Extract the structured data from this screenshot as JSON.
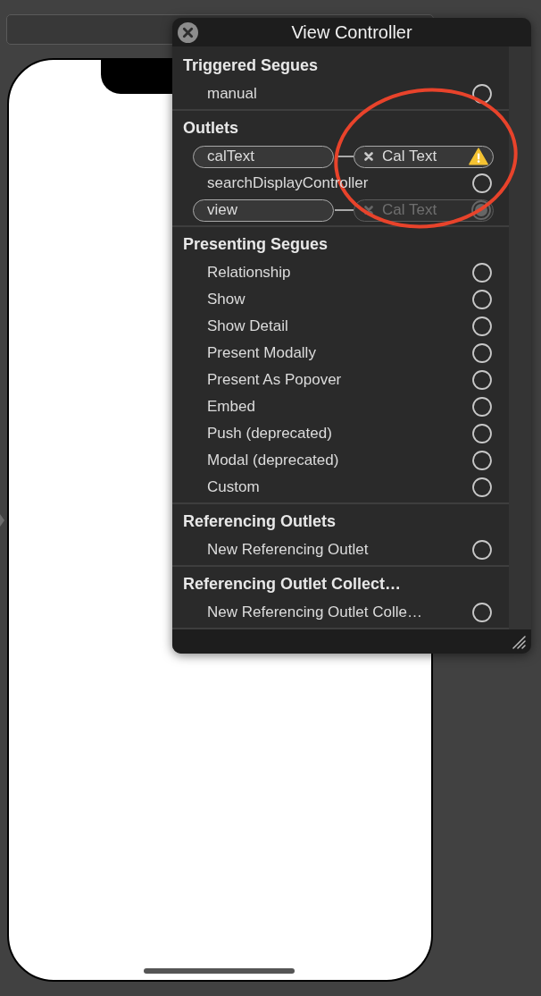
{
  "panel": {
    "title": "View Controller"
  },
  "sections": [
    {
      "title": "Triggered Segues",
      "rows": [
        {
          "kind": "plain",
          "label": "manual"
        }
      ]
    },
    {
      "title": "Outlets",
      "rows": [
        {
          "kind": "connection",
          "label": "calText",
          "target": {
            "label": "Cal Text",
            "warning": true,
            "dimmed": false
          }
        },
        {
          "kind": "plain",
          "label": "searchDisplayController"
        },
        {
          "kind": "connection",
          "label": "view",
          "target": {
            "label": "Cal Text",
            "warning": false,
            "dimmed": true
          }
        }
      ]
    },
    {
      "title": "Presenting Segues",
      "rows": [
        {
          "kind": "plain",
          "label": "Relationship"
        },
        {
          "kind": "plain",
          "label": "Show"
        },
        {
          "kind": "plain",
          "label": "Show Detail"
        },
        {
          "kind": "plain",
          "label": "Present Modally"
        },
        {
          "kind": "plain",
          "label": "Present As Popover"
        },
        {
          "kind": "plain",
          "label": "Embed"
        },
        {
          "kind": "plain",
          "label": "Push (deprecated)"
        },
        {
          "kind": "plain",
          "label": "Modal (deprecated)"
        },
        {
          "kind": "plain",
          "label": "Custom"
        }
      ]
    },
    {
      "title": "Referencing Outlets",
      "rows": [
        {
          "kind": "plain",
          "label": "New Referencing Outlet"
        }
      ]
    },
    {
      "title": "Referencing Outlet Collect…",
      "rows": [
        {
          "kind": "plain",
          "label": "New Referencing Outlet Colle…"
        }
      ]
    }
  ]
}
